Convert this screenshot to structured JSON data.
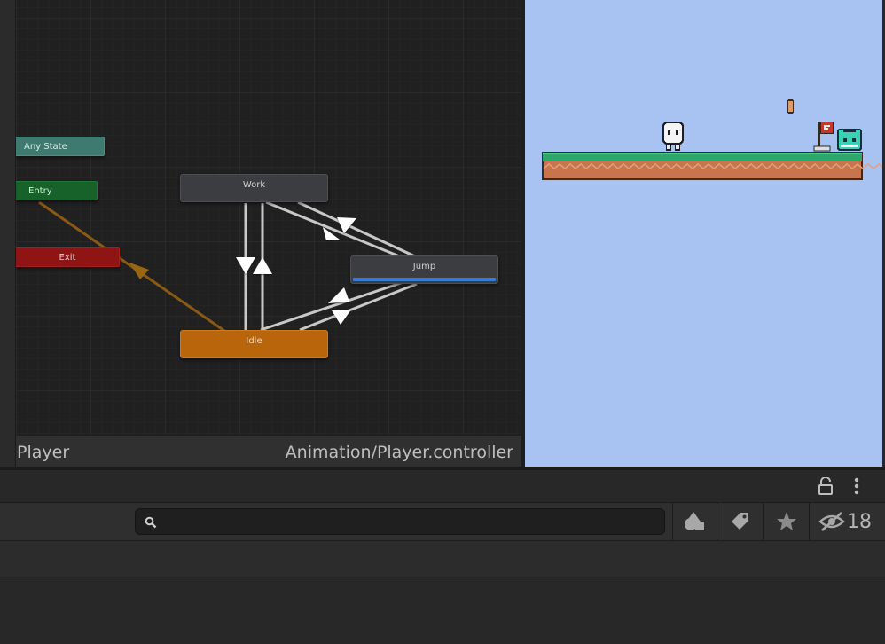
{
  "animator": {
    "nodes": {
      "any_state": "Any State",
      "entry": "Entry",
      "exit": "Exit",
      "work": "Work",
      "jump": "Jump",
      "idle": "Idle"
    },
    "footer_left": "Player",
    "footer_right": "Animation/Player.controller"
  },
  "search": {
    "placeholder": ""
  },
  "toolbar": {
    "hidden_count": "18"
  },
  "icons": [
    "lock-icon",
    "kebab-menu-icon",
    "search-icon",
    "shapes-icon",
    "tag-icon",
    "star-icon",
    "eye-slash-icon"
  ],
  "colors": {
    "any_state": "#3e7a6f",
    "entry": "#17622a",
    "exit": "#8f1414",
    "idle": "#b8650c",
    "sky": "#a8c3f1",
    "grass": "#2fa66a",
    "progress": "#3a7bd5"
  }
}
